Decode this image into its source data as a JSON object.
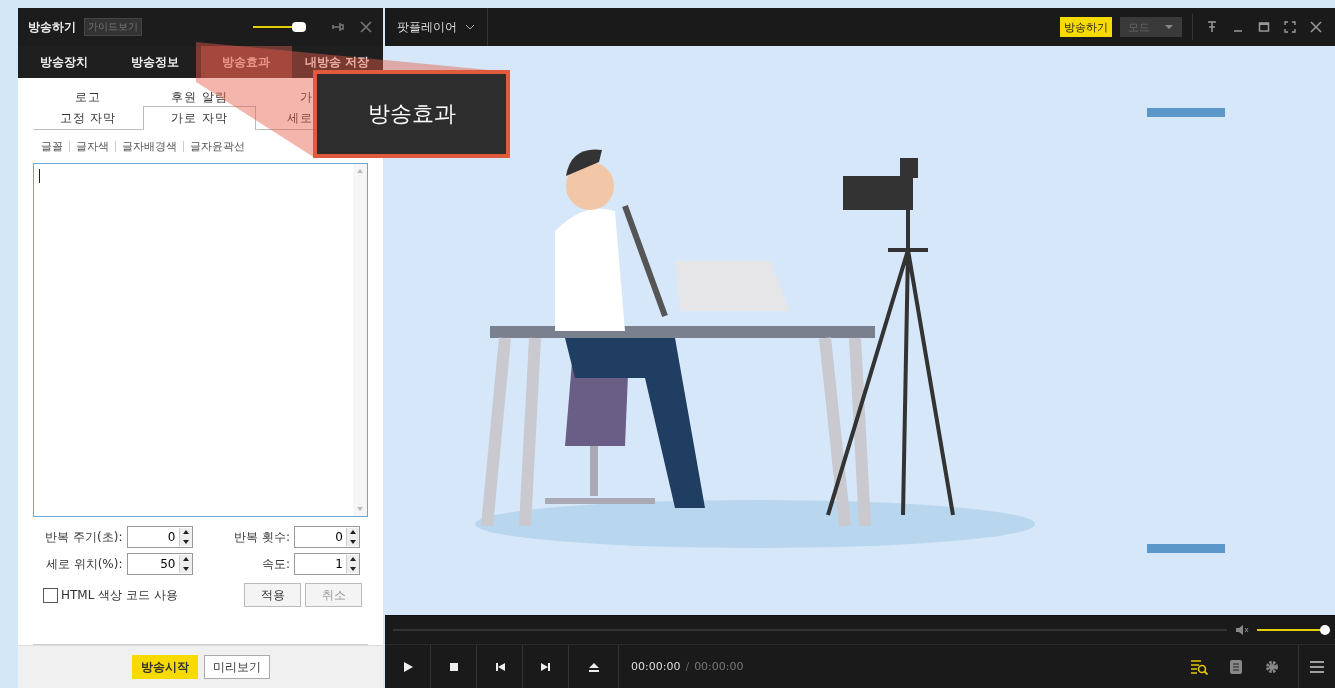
{
  "panel": {
    "title": "방송하기",
    "guide_button": "가이드보기",
    "opacity_slider": {
      "level": 0.88
    },
    "main_tabs": [
      {
        "label": "방송장치",
        "selected": false
      },
      {
        "label": "방송정보",
        "selected": false
      },
      {
        "label": "방송효과",
        "selected": true
      },
      {
        "label": "내방송 저장",
        "selected": false
      }
    ],
    "sub_tabs_top": [
      {
        "label": "로고"
      },
      {
        "label": "후원 알림"
      },
      {
        "label": "가"
      }
    ],
    "sub_tabs_bottom": [
      {
        "label": "고정 자막",
        "selected": false
      },
      {
        "label": "가로 자막",
        "selected": true
      },
      {
        "label": "세로",
        "selected": false
      }
    ],
    "format_toolbar": [
      "글꼴",
      "글자색",
      "글자배경색",
      "글자윤곽선"
    ],
    "fields": [
      {
        "label": "반복 주기(초):",
        "value": "0"
      },
      {
        "label": "반복 횟수:",
        "value": "0"
      },
      {
        "label": "세로 위치(%):",
        "value": "50"
      },
      {
        "label": "속도:",
        "value": "1"
      }
    ],
    "checkbox": {
      "label": "HTML 색상 코드 사용",
      "checked": false
    },
    "form_buttons": [
      {
        "label": "적용",
        "disabled": false
      },
      {
        "label": "취소",
        "disabled": true
      }
    ],
    "footer_buttons": [
      {
        "label": "방송시작",
        "kind": "primary"
      },
      {
        "label": "미리보기",
        "kind": "default"
      }
    ]
  },
  "callout": {
    "label": "방송효과"
  },
  "player": {
    "title": "팟플레이어",
    "broadcast_button": "방송하기",
    "mode_dropdown": {
      "label": "모드",
      "disabled": true
    },
    "volume": {
      "level": 0.97
    },
    "time_current": "00:00:00",
    "time_separator": "/",
    "time_total": "00:00:00"
  }
}
